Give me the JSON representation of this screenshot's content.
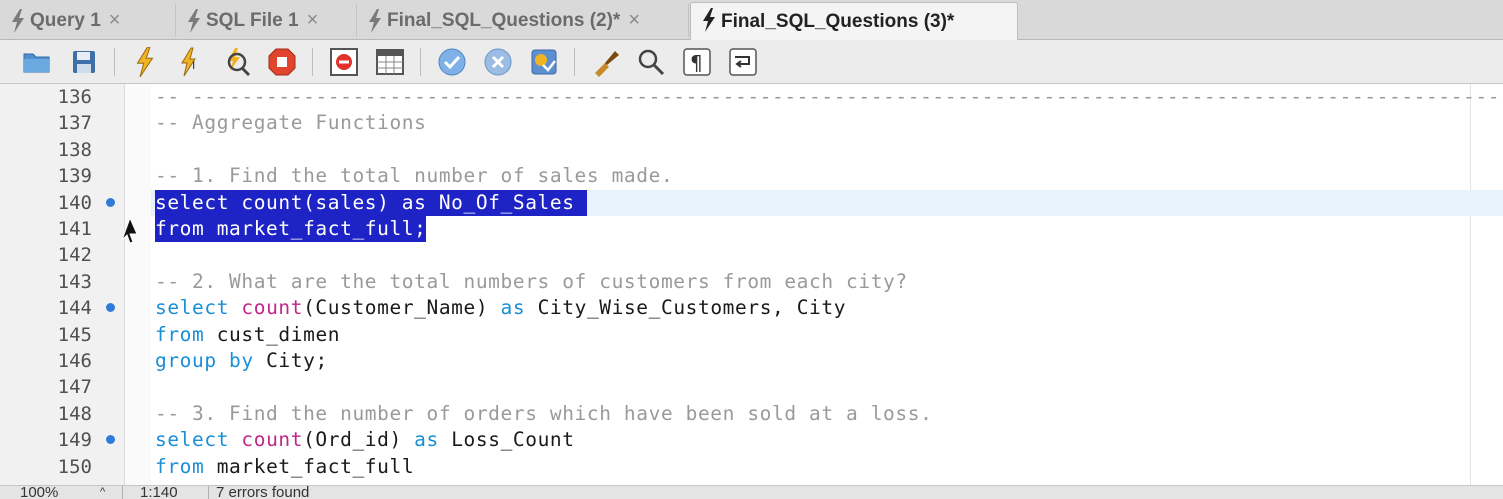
{
  "tabs": [
    {
      "label": "Query 1",
      "close": "×",
      "active": false
    },
    {
      "label": "SQL File 1",
      "close": "×",
      "active": false
    },
    {
      "label": "Final_SQL_Questions (2)*",
      "close": "×",
      "active": false
    },
    {
      "label": "Final_SQL_Questions (3)*",
      "close": "",
      "active": true
    }
  ],
  "toolbar": {
    "icons": [
      "open-folder-icon",
      "save-icon",
      "execute-icon",
      "execute-current-icon",
      "explain-icon",
      "stop-icon",
      "toggle-error-icon",
      "toggle-results-icon",
      "commit-icon",
      "rollback-icon",
      "autocommit-icon",
      "beautify-icon",
      "find-icon",
      "invisibles-icon",
      "wrap-icon"
    ]
  },
  "editor": {
    "lines": [
      {
        "num": "136",
        "text": "-- ------------------------------------------------------------------------------------------------------------"
      },
      {
        "num": "137",
        "text": "-- Aggregate Functions"
      },
      {
        "num": "138",
        "text": ""
      },
      {
        "num": "139",
        "text": "-- 1. Find the total number of sales made."
      },
      {
        "num": "140",
        "text": "select count(sales) as No_Of_Sales "
      },
      {
        "num": "141",
        "text": "from market_fact_full;"
      },
      {
        "num": "142",
        "text": ""
      },
      {
        "num": "143",
        "text": "-- 2. What are the total numbers of customers from each city?"
      },
      {
        "num": "144",
        "kw1": "select",
        "fn": "count",
        "rest": "(Customer_Name)",
        "kw2": "as",
        "tail": "City_Wise_Customers, City"
      },
      {
        "num": "145",
        "kw1": "from",
        "tail": "cust_dimen"
      },
      {
        "num": "146",
        "kw1": "group by",
        "tail": "City;"
      },
      {
        "num": "147",
        "text": ""
      },
      {
        "num": "148",
        "text": "-- 3. Find the number of orders which have been sold at a loss."
      },
      {
        "num": "149",
        "kw1": "select",
        "fn": "count",
        "rest": "(Ord_id)",
        "kw2": "as",
        "tail": "Loss_Count"
      },
      {
        "num": "150",
        "kw1": "from",
        "tail": "market_fact_full"
      }
    ]
  },
  "status": {
    "zoom": "100%",
    "position": "1:140",
    "errors": "7 errors found"
  },
  "colors": {
    "selection": "#1d23c4",
    "keyword": "#1a8fd6",
    "function": "#c2268a",
    "comment": "#9a9a9a",
    "breakpoint": "#2f7bd8"
  }
}
